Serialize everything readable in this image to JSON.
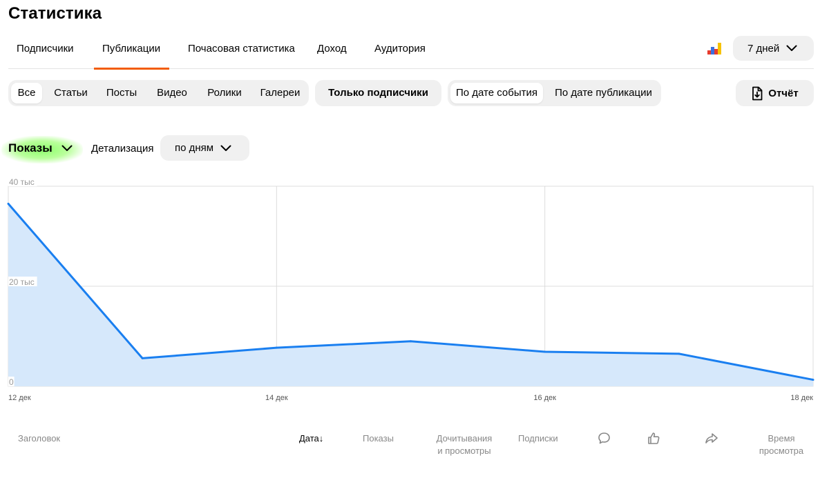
{
  "page": {
    "title": "Статистика"
  },
  "main_tabs": [
    {
      "label": "Подписчики",
      "active": false
    },
    {
      "label": "Публикации",
      "active": true
    },
    {
      "label": "Почасовая статистика",
      "active": false
    },
    {
      "label": "Доход",
      "active": false
    },
    {
      "label": "Аудитория",
      "active": false
    }
  ],
  "period": {
    "label": "7 дней"
  },
  "type_filters": [
    {
      "label": "Все",
      "active": true
    },
    {
      "label": "Статьи",
      "active": false
    },
    {
      "label": "Посты",
      "active": false
    },
    {
      "label": "Видео",
      "active": false
    },
    {
      "label": "Ролики",
      "active": false
    },
    {
      "label": "Галереи",
      "active": false
    }
  ],
  "subscribers_only": {
    "label": "Только подписчики"
  },
  "date_modes": [
    {
      "label": "По дате события",
      "active": true
    },
    {
      "label": "По дате публикации",
      "active": false
    }
  ],
  "report": {
    "label": "Отчёт"
  },
  "metric": {
    "label": "Показы"
  },
  "detail": {
    "label": "Детализация",
    "value": "по дням"
  },
  "colors": {
    "accent": "#f25c05",
    "line": "#1a7ff0",
    "area": "#d6e8fb",
    "highlight": "#7dff5a"
  },
  "chart_data": {
    "type": "area",
    "x": [
      "12 дек",
      "13 дек",
      "14 дек",
      "15 дек",
      "16 дек",
      "17 дек",
      "18 дек"
    ],
    "values": [
      36500,
      5600,
      7700,
      9000,
      6900,
      6500,
      1300
    ],
    "ylim": [
      0,
      40000
    ],
    "y_ticks": [
      {
        "value": 0,
        "label": "0"
      },
      {
        "value": 20000,
        "label": "20 тыс"
      },
      {
        "value": 40000,
        "label": "40 тыс"
      }
    ],
    "x_ticks": [
      {
        "index": 0,
        "label": "12 дек"
      },
      {
        "index": 2,
        "label": "14 дек"
      },
      {
        "index": 4,
        "label": "16 дек"
      },
      {
        "index": 6,
        "label": "18 дек"
      }
    ],
    "grid": true
  },
  "table_headers": {
    "title": "Заголовок",
    "date": "Дата",
    "date_sort": "↓",
    "views": "Показы",
    "readthrough_line1": "Дочитывания",
    "readthrough_line2": "и просмотры",
    "subscriptions": "Подписки",
    "comments_icon": "comment-icon",
    "likes_icon": "like-icon",
    "shares_icon": "share-icon",
    "time_line1": "Время",
    "time_line2": "просмотра"
  }
}
